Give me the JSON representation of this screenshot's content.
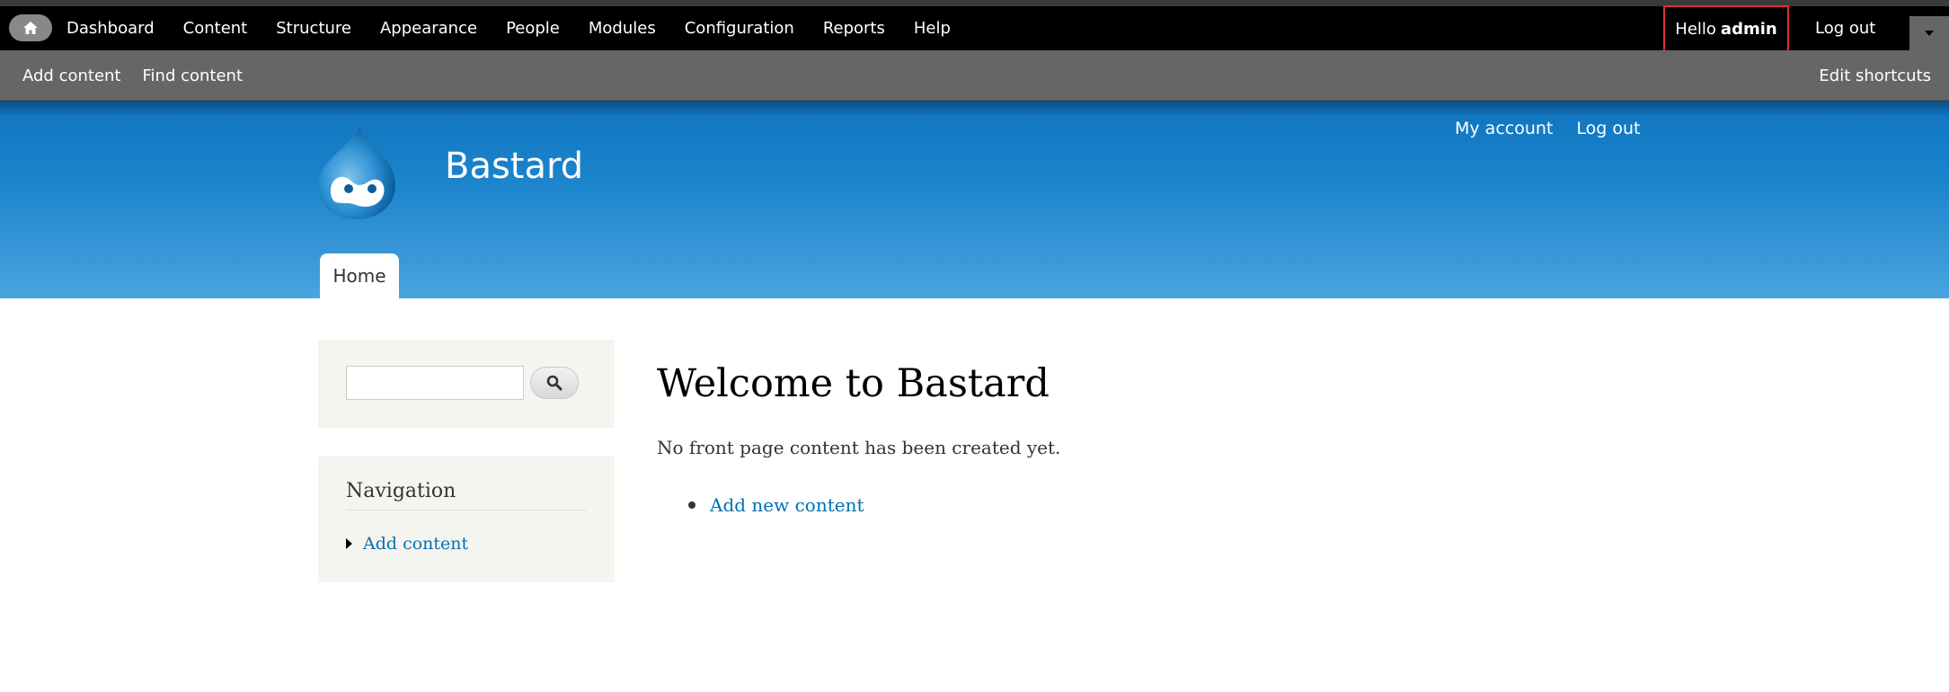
{
  "toolbar": {
    "menu": [
      "Dashboard",
      "Content",
      "Structure",
      "Appearance",
      "People",
      "Modules",
      "Configuration",
      "Reports",
      "Help"
    ],
    "hello_label": "Hello",
    "username": "admin",
    "logout": "Log out"
  },
  "shortcuts": {
    "items": [
      "Add content",
      "Find content"
    ],
    "edit": "Edit shortcuts"
  },
  "header": {
    "site_name": "Bastard",
    "secondary_menu": [
      "My account",
      "Log out"
    ],
    "main_tab": "Home"
  },
  "sidebar": {
    "search_placeholder": "",
    "navigation_title": "Navigation",
    "nav_items": [
      "Add content"
    ]
  },
  "main": {
    "title": "Welcome to Bastard",
    "text": "No front page content has been created yet.",
    "links": [
      "Add new content"
    ]
  },
  "colors": {
    "header_blue": "#1b84cb",
    "link": "#0071b3",
    "toolbar": "#000000",
    "shortcuts": "#666666",
    "highlight": "#e03030"
  }
}
